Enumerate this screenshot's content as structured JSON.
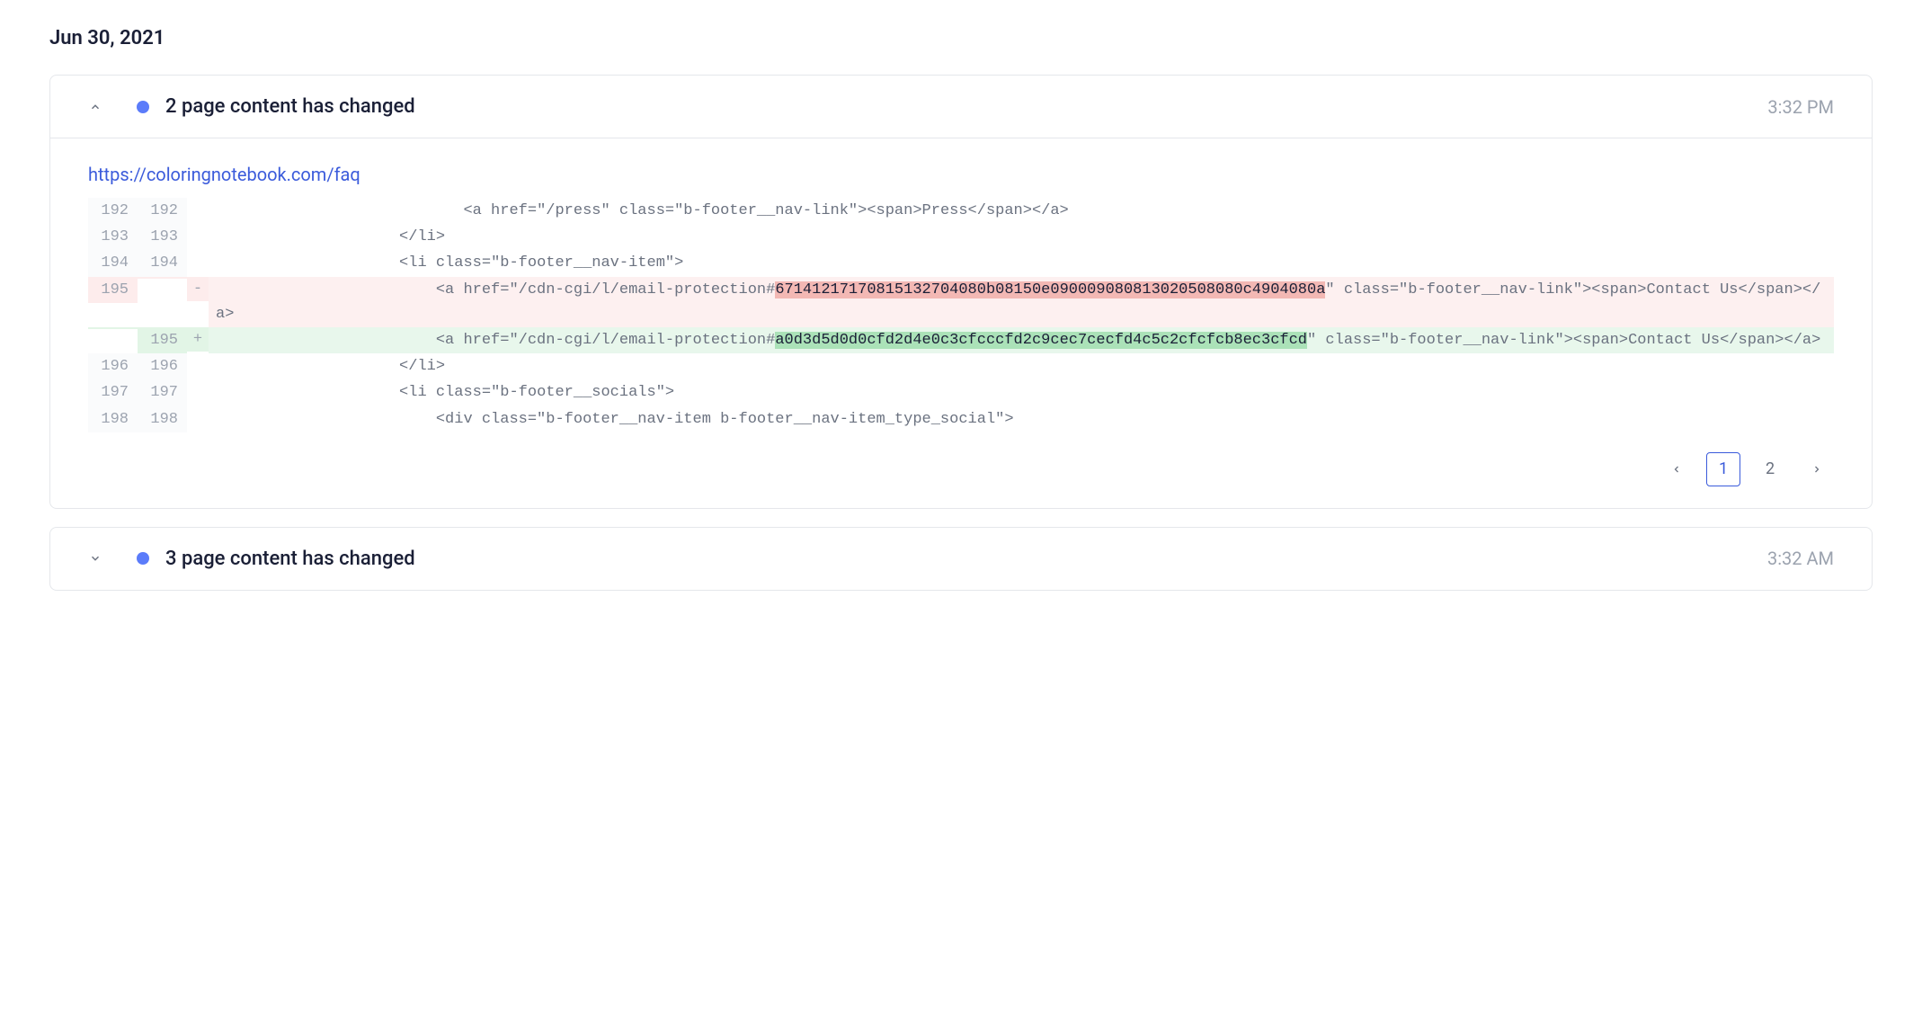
{
  "date": "Jun 30, 2021",
  "entries": [
    {
      "expanded": true,
      "title": "2 page content has changed",
      "time": "3:32 PM",
      "url": "https://coloringnotebook.com/faq",
      "diff": {
        "rows": [
          {
            "old": "192",
            "new": "192",
            "marker": "",
            "type": "ctx",
            "segments": [
              {
                "t": "                           <a href=\"/press\" class=\"b-footer__nav-link\"><span>Press</span></a>"
              }
            ]
          },
          {
            "old": "193",
            "new": "193",
            "marker": "",
            "type": "ctx",
            "segments": [
              {
                "t": "                    </li>"
              }
            ]
          },
          {
            "old": "194",
            "new": "194",
            "marker": "",
            "type": "ctx",
            "segments": [
              {
                "t": "                    <li class=\"b-footer__nav-item\">"
              }
            ]
          },
          {
            "old": "195",
            "new": "",
            "marker": "-",
            "type": "del",
            "segments": [
              {
                "t": "                        <a href=\"/cdn-cgi/l/email-protection#"
              },
              {
                "t": "67141217170815132704080b08150e090009080813020508080c4904080a",
                "hl": true
              },
              {
                "t": "\" class=\"b-footer__nav-link\"><span>Contact Us</span></a>"
              }
            ]
          },
          {
            "old": "",
            "new": "195",
            "marker": "+",
            "type": "add",
            "segments": [
              {
                "t": "                        <a href=\"/cdn-cgi/l/email-protection#"
              },
              {
                "t": "a0d3d5d0d0cfd2d4e0c3cfcccfd2c9cec7cecfd4c5c2cfcfcb8ec3cfcd",
                "hl": true
              },
              {
                "t": "\" class=\"b-footer__nav-link\"><span>Contact Us</span></a>"
              }
            ]
          },
          {
            "old": "196",
            "new": "196",
            "marker": "",
            "type": "ctx",
            "segments": [
              {
                "t": "                    </li>"
              }
            ]
          },
          {
            "old": "197",
            "new": "197",
            "marker": "",
            "type": "ctx",
            "segments": [
              {
                "t": "                    <li class=\"b-footer__socials\">"
              }
            ]
          },
          {
            "old": "198",
            "new": "198",
            "marker": "",
            "type": "ctx",
            "segments": [
              {
                "t": "                        <div class=\"b-footer__nav-item b-footer__nav-item_type_social\">"
              }
            ]
          }
        ]
      },
      "pagination": {
        "pages": [
          "1",
          "2"
        ],
        "active": 0
      }
    },
    {
      "expanded": false,
      "title": "3 page content has changed",
      "time": "3:32 AM"
    }
  ]
}
